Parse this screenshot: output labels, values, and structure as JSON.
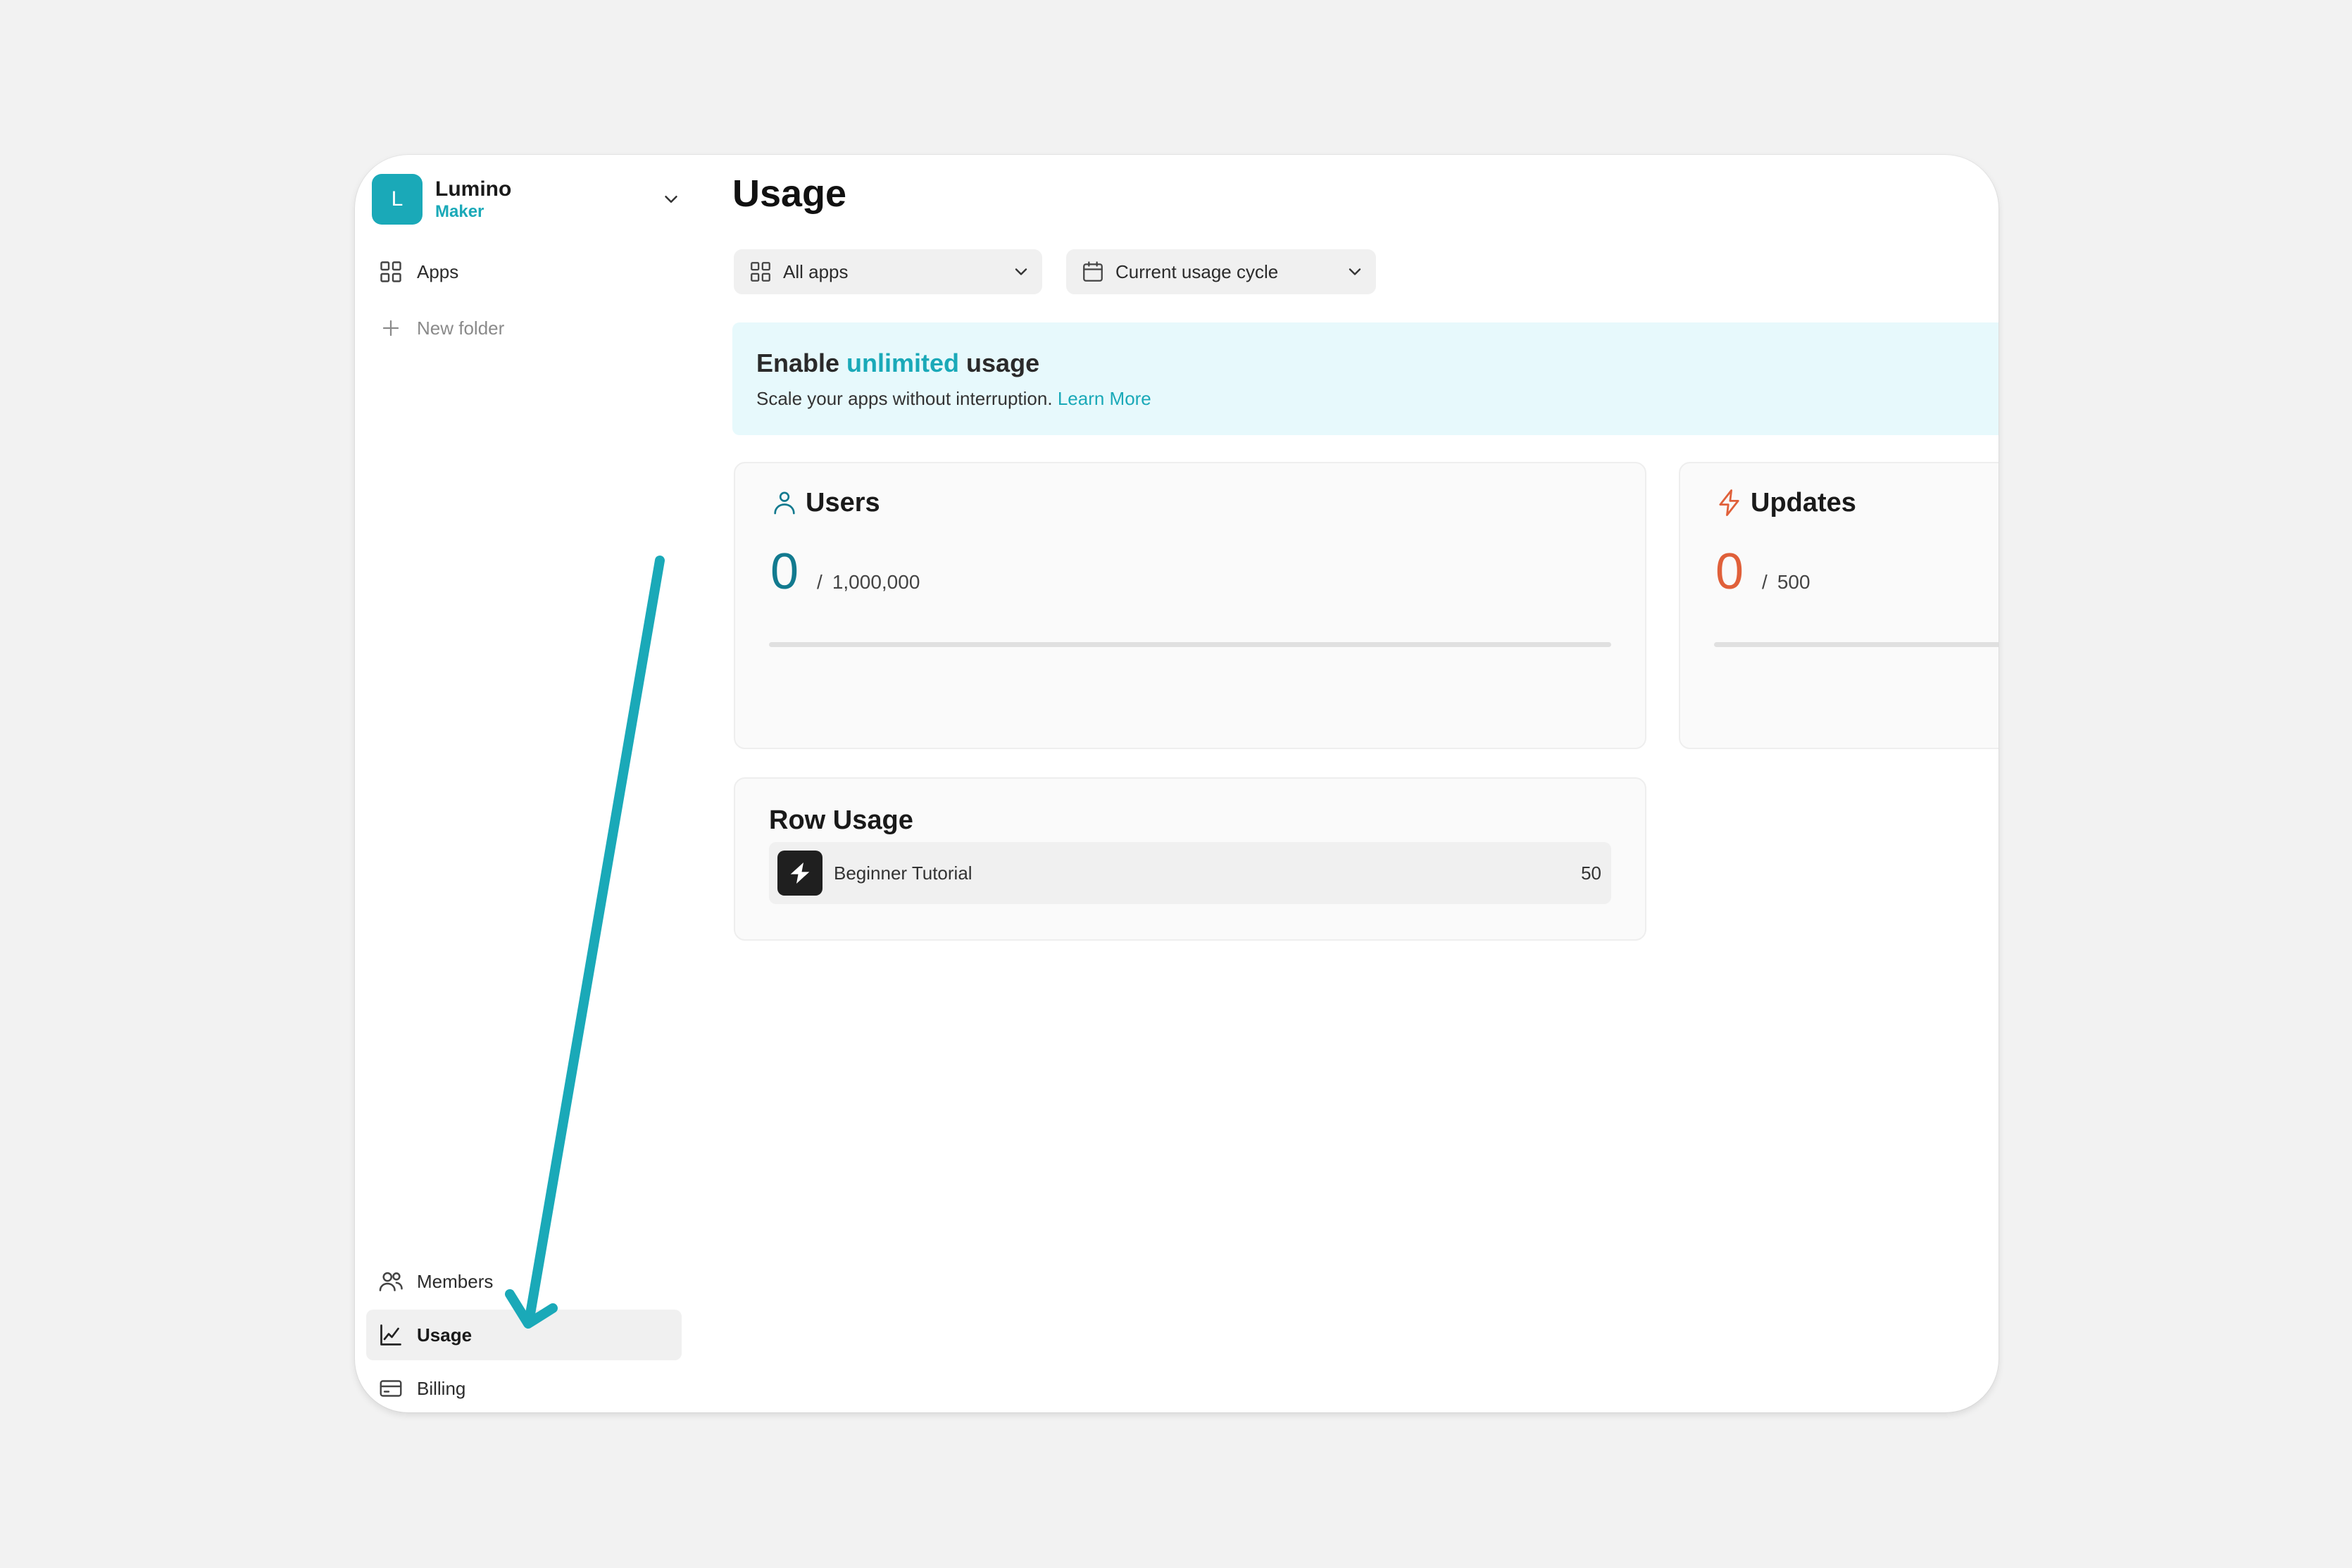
{
  "colors": {
    "accent": "#1aa9b8",
    "users_value": "#127a8f",
    "updates": "#e0603a",
    "banner_bg": "#e7f9fc",
    "annotation_arrow": "#1aa9b8"
  },
  "org": {
    "initial": "L",
    "name": "Lumino",
    "plan": "Maker",
    "menu_icon": "chevron-down-icon"
  },
  "sidebar": {
    "top_items": [
      {
        "label": "Apps",
        "icon": "grid-icon"
      },
      {
        "label": "New folder",
        "icon": "plus-icon"
      }
    ],
    "bottom_items": [
      {
        "label": "Members",
        "icon": "users-icon"
      },
      {
        "label": "Usage",
        "icon": "chart-line-icon",
        "active": true
      },
      {
        "label": "Billing",
        "icon": "credit-card-icon"
      }
    ]
  },
  "main": {
    "title": "Usage",
    "filters": [
      {
        "label": "All apps",
        "icon": "grid-icon"
      },
      {
        "label": "Current usage cycle",
        "icon": "calendar-icon"
      }
    ],
    "banner": {
      "title_before": "Enable ",
      "title_highlight": "unlimited",
      "title_after": " usage",
      "subtitle": "Scale your apps without interruption.",
      "link": "Learn More"
    },
    "stats": [
      {
        "title": "Users",
        "icon": "user-icon",
        "value": "0",
        "separator": "/",
        "limit": "1,000,000",
        "progress": 0
      },
      {
        "title": "Updates",
        "icon": "lightning-icon",
        "value": "0",
        "separator": "/",
        "limit": "500",
        "progress": 0
      }
    ],
    "row_usage": {
      "title": "Row Usage",
      "items": [
        {
          "name": "Beginner Tutorial",
          "count": "50",
          "icon": "bolt-logo-icon"
        }
      ]
    }
  }
}
